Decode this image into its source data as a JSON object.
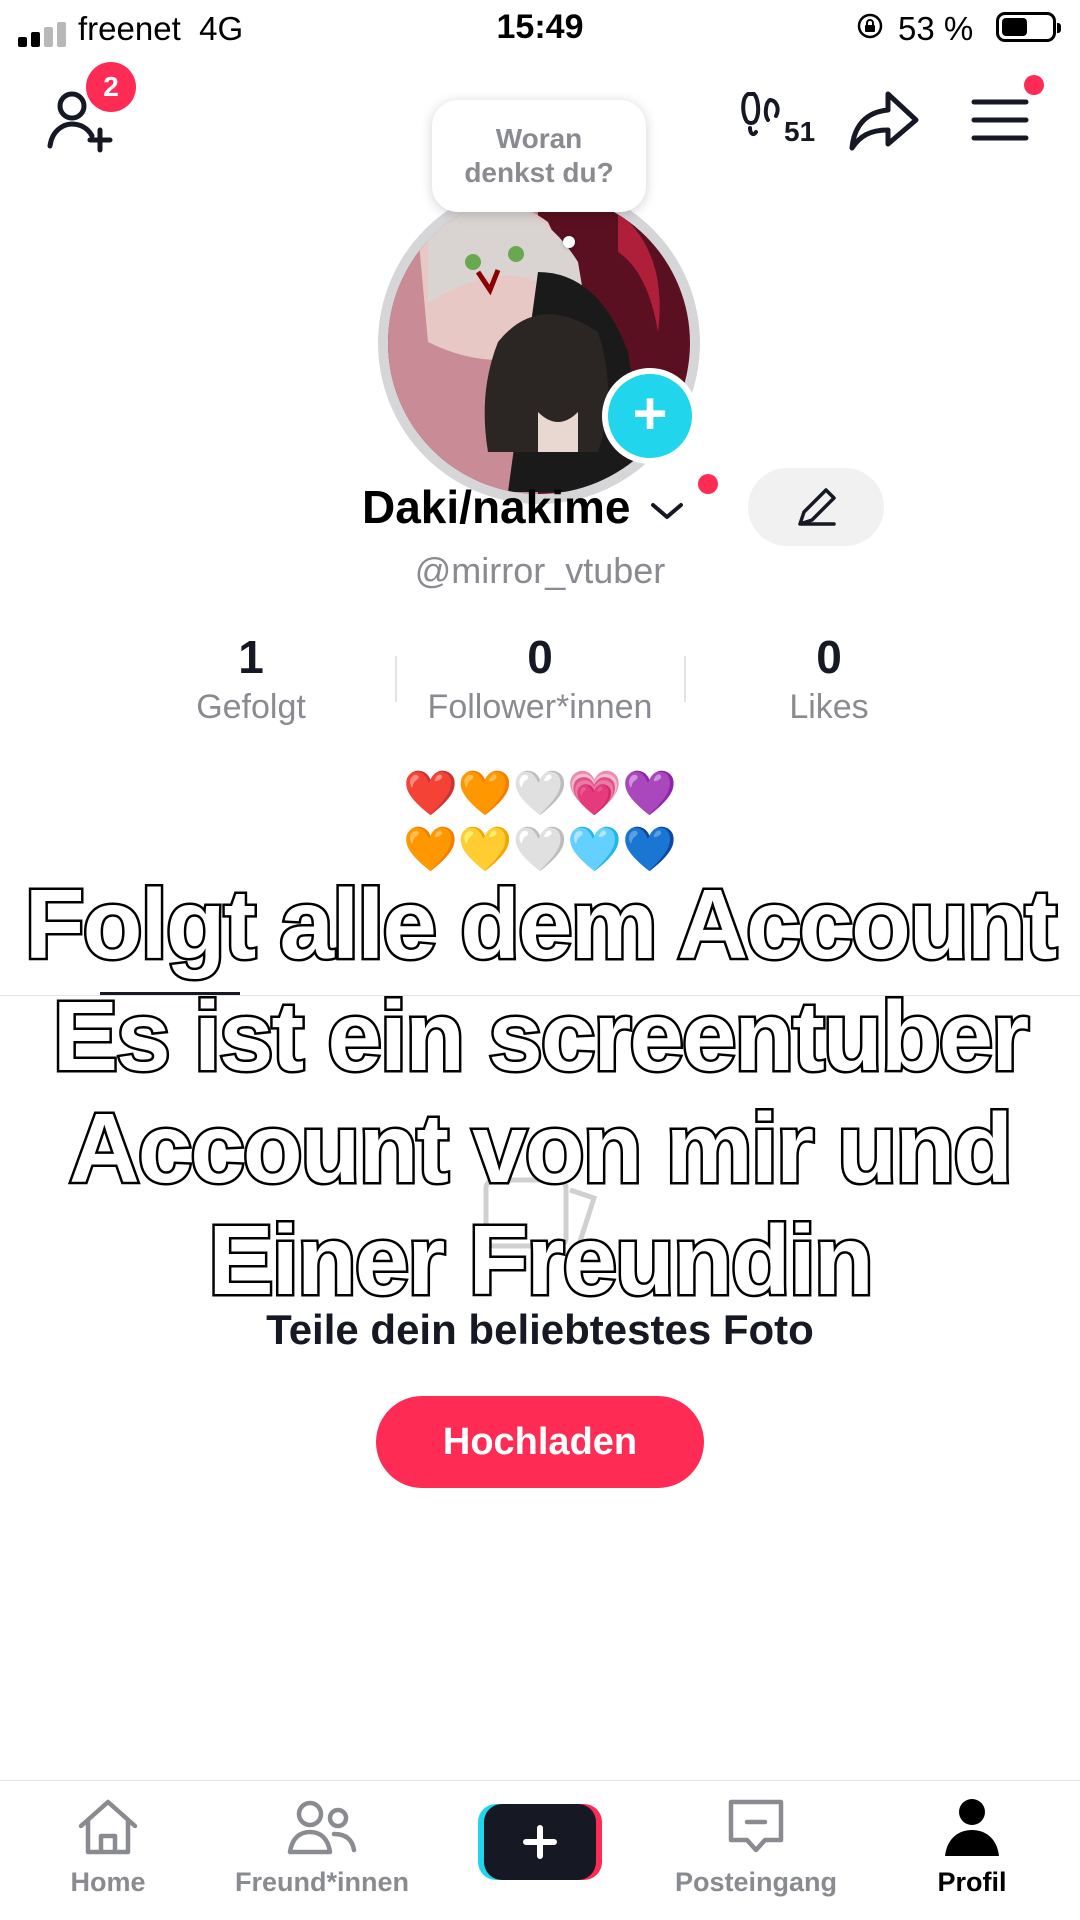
{
  "status_bar": {
    "carrier": "freenet",
    "network": "4G",
    "time": "15:49",
    "battery_pct": "53 %",
    "battery_level": 0.53
  },
  "header": {
    "add_friend_badge": "2",
    "profile_views": "51"
  },
  "profile": {
    "bubble_text_line1": "Woran",
    "bubble_text_line2": "denkst du?",
    "display_name": "Daki/nakime",
    "handle": "@mirror_vtuber",
    "stats": [
      {
        "value": "1",
        "label": "Gefolgt"
      },
      {
        "value": "0",
        "label": "Follower*innen"
      },
      {
        "value": "0",
        "label": "Likes"
      }
    ],
    "bio_line1": "❤️🧡🤍💗💜",
    "bio_line2": "🧡💛🤍🩵💙"
  },
  "empty_state": {
    "title": "Teile dein beliebtestes Foto",
    "upload_label": "Hochladen"
  },
  "overlay_caption": [
    "Folgt alle dem Account",
    "Es ist ein screentuber",
    "Account von mir und",
    "Einer Freundin"
  ],
  "nav": {
    "home": "Home",
    "friends": "Freund*innen",
    "inbox": "Posteingang",
    "profile": "Profil"
  },
  "colors": {
    "accent": "#fe2c55",
    "cyan": "#20d5ec",
    "text_secondary": "#8a8b91"
  }
}
